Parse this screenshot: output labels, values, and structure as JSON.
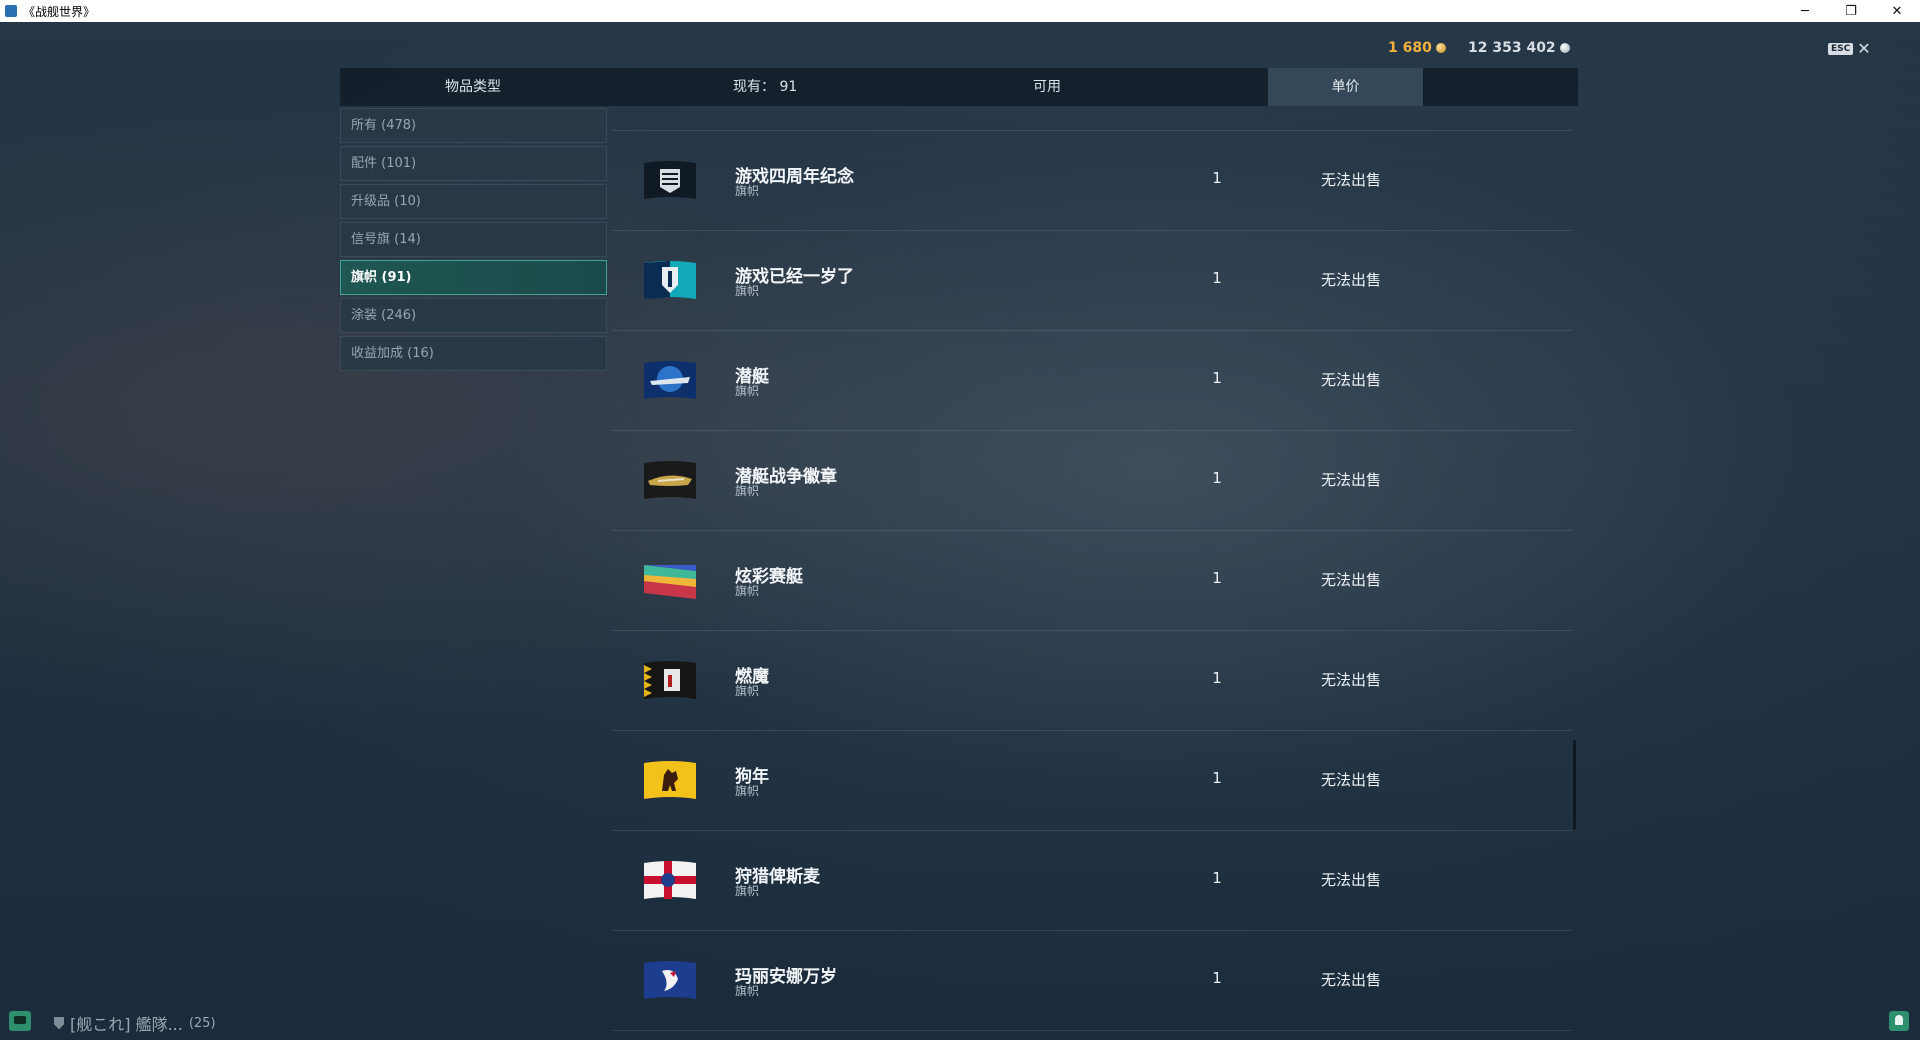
{
  "window": {
    "title": "《战舰世界》",
    "minimize": "─",
    "restore": "❐",
    "close": "✕"
  },
  "currency": {
    "gold": "1 680",
    "credits": "12 353 402",
    "gold_color": "#f2b23c"
  },
  "esc": {
    "badge": "ESC",
    "close": "✕"
  },
  "header": {
    "type_label": "物品类型",
    "owned_label": "现有： 91",
    "avail_label": "可用",
    "price_label": "单价"
  },
  "sidebar": {
    "items": [
      {
        "label": "所有 (478)"
      },
      {
        "label": "配件 (101)"
      },
      {
        "label": "升级品 (10)"
      },
      {
        "label": "信号旗 (14)"
      },
      {
        "label": "旗帜 (91)",
        "active": true
      },
      {
        "label": "涂装 (246)"
      },
      {
        "label": "收益加成 (16)"
      }
    ]
  },
  "list": {
    "items": [
      {
        "name": "游戏四周年纪念",
        "type": "旗帜",
        "available": "1",
        "price": "无法出售",
        "icon": "chevron-rank-flag-icon"
      },
      {
        "name": "游戏已经一岁了",
        "type": "旗帜",
        "available": "1",
        "price": "无法出售",
        "icon": "wows-shield-flag-icon"
      },
      {
        "name": "潜艇",
        "type": "旗帜",
        "available": "1",
        "price": "无法出售",
        "icon": "submarine-flag-icon"
      },
      {
        "name": "潜艇战争徽章",
        "type": "旗帜",
        "available": "1",
        "price": "无法出售",
        "icon": "submarine-badge-flag-icon"
      },
      {
        "name": "炫彩赛艇",
        "type": "旗帜",
        "available": "1",
        "price": "无法出售",
        "icon": "rainbow-flag-icon"
      },
      {
        "name": "燃魔",
        "type": "旗帜",
        "available": "1",
        "price": "无法出售",
        "icon": "demon-flag-icon"
      },
      {
        "name": "狗年",
        "type": "旗帜",
        "available": "1",
        "price": "无法出售",
        "icon": "dog-year-flag-icon"
      },
      {
        "name": "狩猎俾斯麦",
        "type": "旗帜",
        "available": "1",
        "price": "无法出售",
        "icon": "hunt-bismarck-flag-icon"
      },
      {
        "name": "玛丽安娜万岁",
        "type": "旗帜",
        "available": "1",
        "price": "无法出售",
        "icon": "marianne-flag-icon"
      }
    ]
  },
  "bottom": {
    "clan": "[舰これ] 艦隊...",
    "clan_count": "(25)"
  }
}
